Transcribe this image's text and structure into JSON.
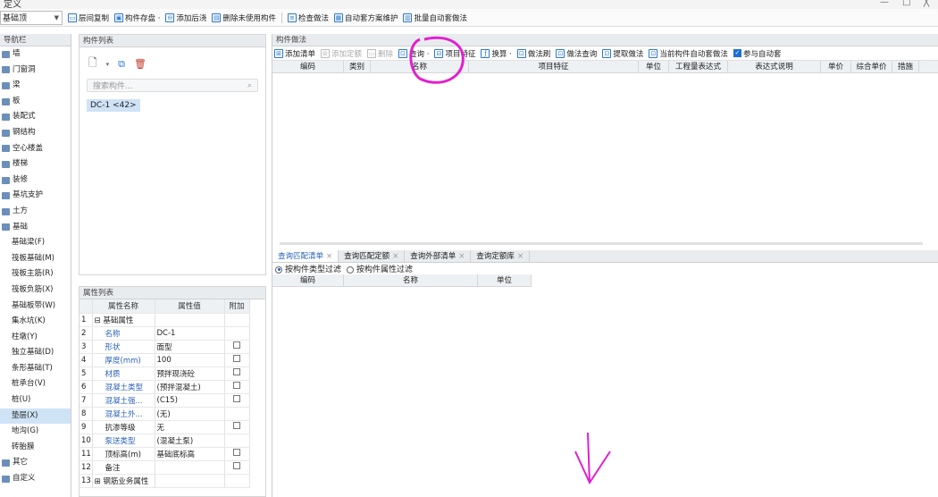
{
  "window": {
    "title": "定义",
    "min": "—",
    "max": "□",
    "close": "╳"
  },
  "toolbar": {
    "scope_combo": "基础顶",
    "items": [
      {
        "icon": "copy-floor-icon",
        "glyph": "▭",
        "label": "层间复制"
      },
      {
        "icon": "store-component-icon",
        "glyph": "▣",
        "label": "构件存盘 ·"
      },
      {
        "icon": "add-pour-strip-icon",
        "glyph": "⊖",
        "label": "添加后浇"
      },
      {
        "icon": "delete-unused-icon",
        "glyph": "▤",
        "label": "删除未使用构件"
      },
      {
        "icon": "check-method-icon",
        "glyph": "≡",
        "label": "检查做法"
      },
      {
        "icon": "auto-set-icon",
        "glyph": "▦",
        "label": "自动套方案维护"
      },
      {
        "icon": "batch-auto-icon",
        "glyph": "▥",
        "label": "批量自动套做法"
      }
    ]
  },
  "nav": {
    "title": "导航栏",
    "items": [
      {
        "label": "墙",
        "level": 0
      },
      {
        "label": "门窗洞",
        "level": 0
      },
      {
        "label": "梁",
        "level": 0
      },
      {
        "label": "板",
        "level": 0
      },
      {
        "label": "装配式",
        "level": 0
      },
      {
        "label": "钢结构",
        "level": 0
      },
      {
        "label": "空心楼盖",
        "level": 0
      },
      {
        "label": "楼梯",
        "level": 0
      },
      {
        "label": "装修",
        "level": 0
      },
      {
        "label": "基坑支护",
        "level": 0
      },
      {
        "label": "土方",
        "level": 0
      },
      {
        "label": "基础",
        "level": 0
      },
      {
        "label": "基础梁(F)",
        "level": 1
      },
      {
        "label": "筏板基础(M)",
        "level": 1
      },
      {
        "label": "筏板主筋(R)",
        "level": 1
      },
      {
        "label": "筏板负筋(X)",
        "level": 1
      },
      {
        "label": "基础板带(W)",
        "level": 1
      },
      {
        "label": "集水坑(K)",
        "level": 1
      },
      {
        "label": "柱墩(Y)",
        "level": 1
      },
      {
        "label": "独立基础(D)",
        "level": 1
      },
      {
        "label": "条形基础(T)",
        "level": 1
      },
      {
        "label": "桩承台(V)",
        "level": 1
      },
      {
        "label": "桩(U)",
        "level": 1
      },
      {
        "label": "垫层(X)",
        "level": 1,
        "selected": true
      },
      {
        "label": "地沟(G)",
        "level": 1
      },
      {
        "label": "砖胎膜",
        "level": 1
      },
      {
        "label": "其它",
        "level": 0
      },
      {
        "label": "自定义",
        "level": 0
      }
    ]
  },
  "component_list": {
    "title": "构件列表",
    "search_placeholder": "搜索构件...",
    "items": [
      "DC-1 <42>"
    ]
  },
  "properties": {
    "title": "属性列表",
    "headers": {
      "name": "属性名称",
      "value": "属性值",
      "extra": "附加"
    },
    "rows": [
      {
        "no": "1",
        "name": "⊟ 基础属性",
        "value": "",
        "blue": false,
        "check": false,
        "group": true
      },
      {
        "no": "2",
        "name": "名称",
        "value": "DC-1",
        "blue": true,
        "check": false
      },
      {
        "no": "3",
        "name": "形状",
        "value": "面型",
        "blue": true,
        "check": true
      },
      {
        "no": "4",
        "name": "厚度(mm)",
        "value": "100",
        "blue": true,
        "check": true
      },
      {
        "no": "5",
        "name": "材质",
        "value": "预拌现浇砼",
        "blue": true,
        "check": true
      },
      {
        "no": "6",
        "name": "混凝土类型",
        "value": "(预拌混凝土)",
        "blue": true,
        "check": true
      },
      {
        "no": "7",
        "name": "混凝土强...",
        "value": "(C15)",
        "blue": true,
        "check": true
      },
      {
        "no": "8",
        "name": "混凝土外...",
        "value": "(无)",
        "blue": true,
        "check": false
      },
      {
        "no": "9",
        "name": "抗渗等级",
        "value": "无",
        "blue": false,
        "check": true
      },
      {
        "no": "10",
        "name": "泵送类型",
        "value": "(混凝土泵)",
        "blue": true,
        "check": false
      },
      {
        "no": "11",
        "name": "顶标高(m)",
        "value": "基础底标高",
        "blue": false,
        "check": true
      },
      {
        "no": "12",
        "name": "备注",
        "value": "",
        "blue": false,
        "check": true
      },
      {
        "no": "13",
        "name": "⊞ 钢筋业务属性",
        "value": "",
        "blue": false,
        "check": false,
        "group": true
      }
    ]
  },
  "method": {
    "title": "构件做法",
    "toolbar": [
      {
        "icon": "add-list-icon",
        "label": "添加清单",
        "disabled": false
      },
      {
        "icon": "add-quota-icon",
        "label": "添加定额",
        "disabled": true
      },
      {
        "icon": "delete-icon",
        "label": "删除",
        "disabled": true
      },
      {
        "icon": "query-icon",
        "label": "查询 ·",
        "disabled": false
      },
      {
        "icon": "item-feature-icon",
        "label": "项目特征",
        "disabled": false
      },
      {
        "icon": "fx-icon",
        "label": "换算 ·",
        "disabled": false
      },
      {
        "icon": "method-brush-icon",
        "label": "做法刷",
        "disabled": false
      },
      {
        "icon": "method-query-icon",
        "label": "做法查询",
        "disabled": false
      },
      {
        "icon": "extract-method-icon",
        "label": "提取做法",
        "disabled": false
      },
      {
        "icon": "current-auto-icon",
        "label": "当前构件自动套做法",
        "disabled": false
      }
    ],
    "participate_label": "参与自动套",
    "columns": [
      "编码",
      "类别",
      "名称",
      "项目特征",
      "单位",
      "工程量表达式",
      "表达式说明",
      "单价",
      "综合单价",
      "措施"
    ]
  },
  "query": {
    "tabs": [
      "查询匹配清单",
      "查询匹配定额",
      "查询外部清单",
      "查询定额库"
    ],
    "filter_type": "按构件类型过滤",
    "filter_attr": "按构件属性过滤",
    "columns": [
      "编码",
      "名称",
      "单位"
    ]
  },
  "annotation": {
    "color": "#e020d0",
    "arrow": "↓"
  }
}
